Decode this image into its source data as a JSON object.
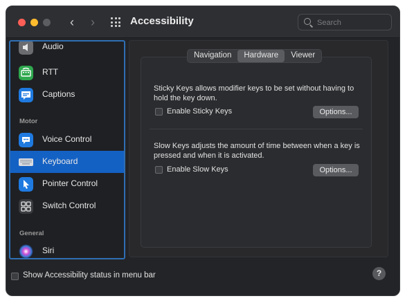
{
  "titlebar": {
    "title": "Accessibility",
    "back_glyph": "‹",
    "forward_glyph": "›",
    "search_placeholder": "Search"
  },
  "sidebar": {
    "items": [
      {
        "label": "Audio",
        "icon": "audio-icon"
      },
      {
        "label": "RTT",
        "icon": "rtt-icon"
      },
      {
        "label": "Captions",
        "icon": "captions-icon"
      },
      {
        "header": "Motor"
      },
      {
        "label": "Voice Control",
        "icon": "voice-control-icon"
      },
      {
        "label": "Keyboard",
        "icon": "keyboard-icon",
        "selected": true
      },
      {
        "label": "Pointer Control",
        "icon": "pointer-icon"
      },
      {
        "label": "Switch Control",
        "icon": "switch-control-icon"
      },
      {
        "header": "General"
      },
      {
        "label": "Siri",
        "icon": "siri-icon"
      }
    ]
  },
  "tabs": [
    {
      "label": "Navigation"
    },
    {
      "label": "Hardware",
      "active": true
    },
    {
      "label": "Viewer"
    }
  ],
  "hardware": {
    "sticky_desc": "Sticky Keys allows modifier keys to be set without having to hold the key down.",
    "sticky_label": "Enable Sticky Keys",
    "sticky_checked": false,
    "slow_desc": "Slow Keys adjusts the amount of time between when a key is pressed and when it is activated.",
    "slow_label": "Enable Slow Keys",
    "slow_checked": false,
    "options_label": "Options..."
  },
  "footer": {
    "status_label": "Show Accessibility status in menu bar",
    "status_checked": false,
    "help_glyph": "?"
  },
  "colors": {
    "accent": "#1461c4",
    "sidebar_focus": "#2f6fb4",
    "window_bg": "#232427"
  }
}
